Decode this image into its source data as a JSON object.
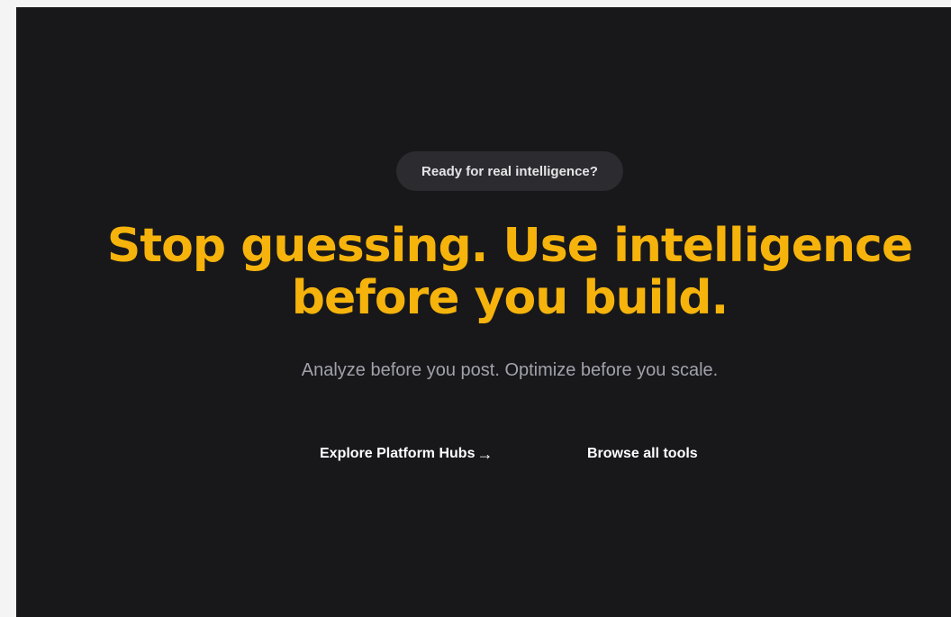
{
  "hero": {
    "badge": "Ready for real intelligence?",
    "headline_line1": "Stop guessing. Use intelligence",
    "headline_line2": "before you build.",
    "subtitle": "Analyze before you post. Optimize before you scale.",
    "primary_cta": "Explore Platform Hubs",
    "primary_cta_icon": "arrow-right-icon",
    "secondary_cta": "Browse all tools"
  },
  "colors": {
    "background": "#18181b",
    "accent": "#f5b30b",
    "badge_background": "#2c2c30",
    "subtitle": "#a1a1aa"
  }
}
